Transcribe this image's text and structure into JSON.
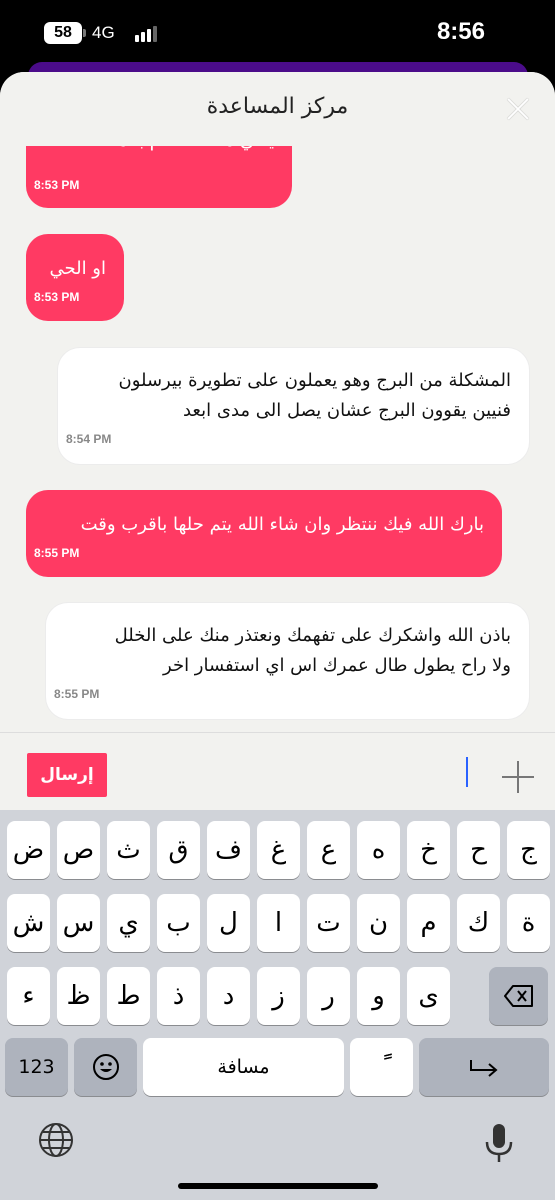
{
  "status": {
    "battery": "58",
    "network": "4G",
    "time": "8:56"
  },
  "sheet": {
    "title": "مركز المساعدة"
  },
  "messages": [
    {
      "text": "يعني مشكلة عام بالمنطقة",
      "time": "8:53 PM",
      "side": "in"
    },
    {
      "text": "او الحي",
      "time": "8:53 PM",
      "side": "in"
    },
    {
      "text": "المشكلة من البرج وهو يعملون على تطويرة بيرسلون\nفنيين يقوون البرج عشان يصل الى مدى ابعد",
      "time": "8:54 PM",
      "side": "out"
    },
    {
      "text": "بارك الله فيك ننتظر وان شاء الله يتم حلها باقرب وقت",
      "time": "8:55 PM",
      "side": "in"
    },
    {
      "text": "باذن الله  واشكرك على تفهمك ونعتذر منك على الخلل\nولا راح يطول طال عمرك اس اي استفسار اخر",
      "time": "8:55 PM",
      "side": "out"
    }
  ],
  "composer": {
    "send_label": "إرسال"
  },
  "keyboard": {
    "row1": [
      "ض",
      "ص",
      "ث",
      "ق",
      "ف",
      "غ",
      "ع",
      "ه",
      "خ",
      "ح",
      "ج"
    ],
    "row2": [
      "ش",
      "س",
      "ي",
      "ب",
      "ل",
      "ا",
      "ت",
      "ن",
      "م",
      "ك",
      "ة"
    ],
    "row3": [
      "ء",
      "ظ",
      "ط",
      "ذ",
      "د",
      "ز",
      "ر",
      "و",
      "ى"
    ],
    "numbers_label": "123",
    "space_label": "مسافة",
    "diacritic_label": "ًً"
  }
}
